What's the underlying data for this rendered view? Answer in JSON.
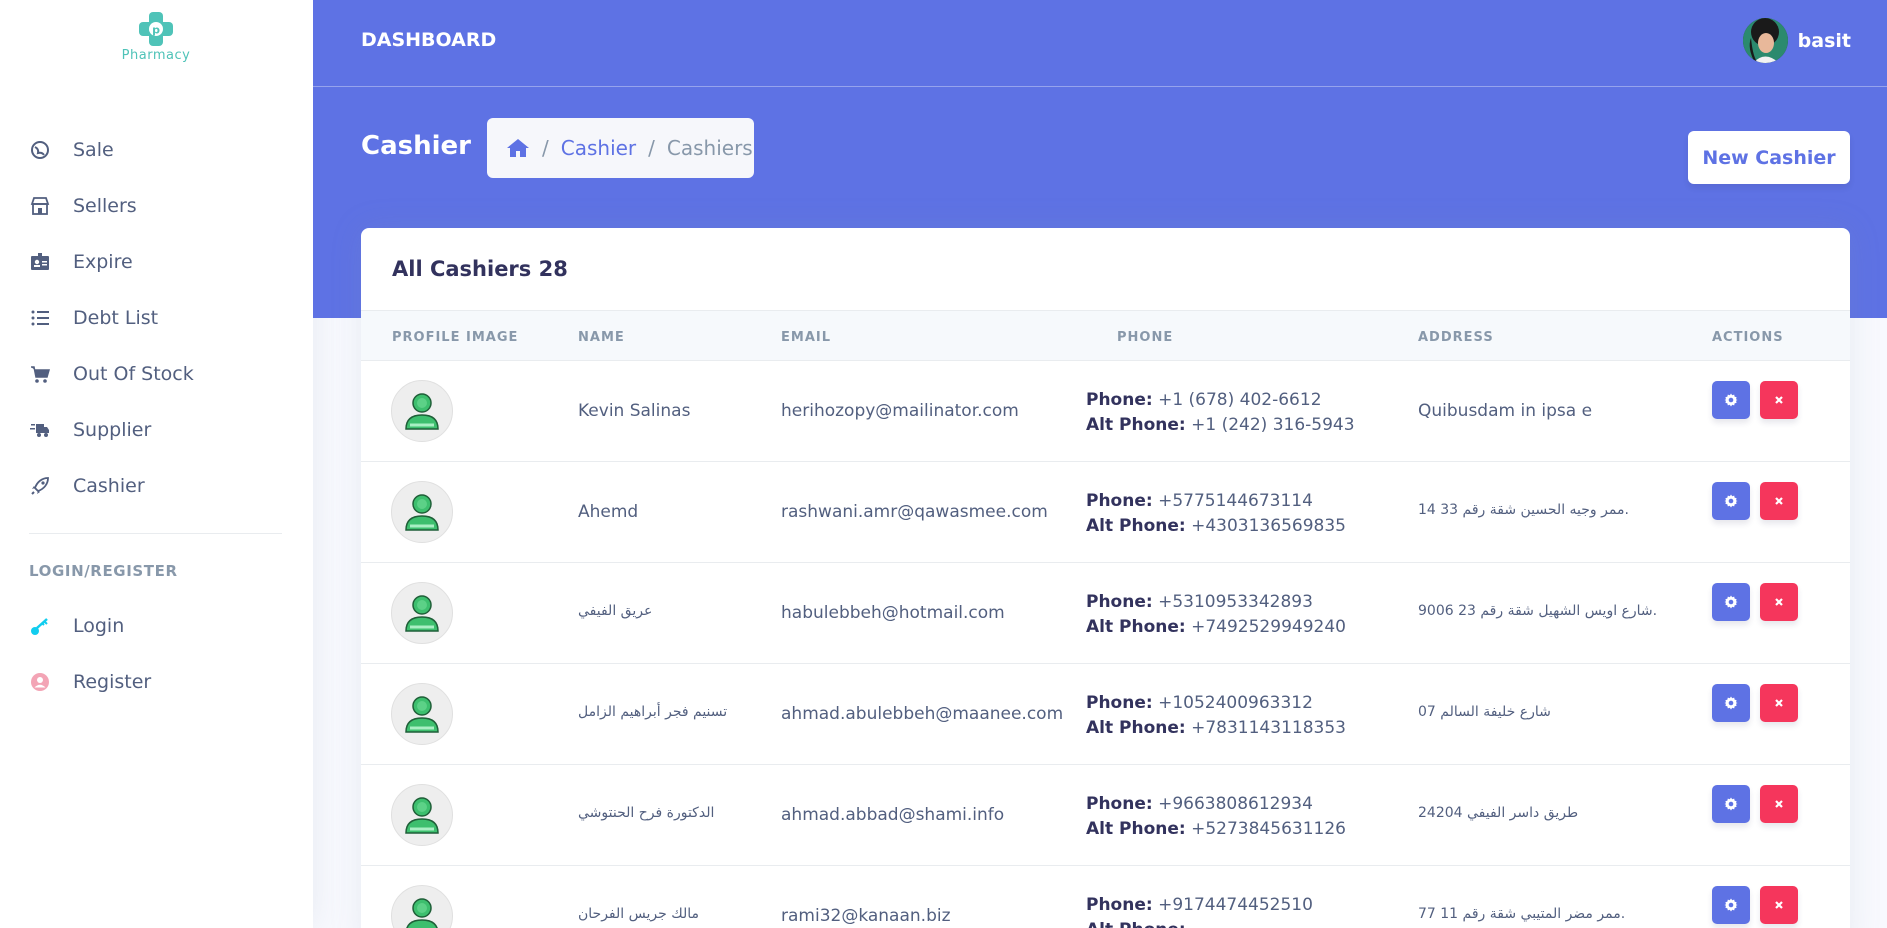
{
  "app": {
    "logo_text": "Pharmacy"
  },
  "sidebar": {
    "items": [
      {
        "label": "Sale",
        "icon": "globe-icon"
      },
      {
        "label": "Sellers",
        "icon": "store-icon"
      },
      {
        "label": "Expire",
        "icon": "id-badge-icon"
      },
      {
        "label": "Debt List",
        "icon": "list-icon"
      },
      {
        "label": "Out Of Stock",
        "icon": "cart-icon"
      },
      {
        "label": "Supplier",
        "icon": "delivery-truck-icon"
      },
      {
        "label": "Cashier",
        "icon": "rocket-icon"
      }
    ],
    "section_heading": "LOGIN/REGISTER",
    "auth_items": [
      {
        "label": "Login",
        "icon": "key-icon",
        "color": "#11cdef"
      },
      {
        "label": "Register",
        "icon": "user-circle-icon",
        "color": "#f3a4b5"
      }
    ]
  },
  "topbar": {
    "title": "DASHBOARD",
    "user_name": "basit"
  },
  "page": {
    "title": "Cashier",
    "breadcrumb": {
      "link": "Cashier",
      "active": "Cashiers",
      "separator": "/"
    },
    "new_button": "New Cashier"
  },
  "table": {
    "title": "All Cashiers 28",
    "columns": [
      "PROFILE IMAGE",
      "NAME",
      "EMAIL",
      "PHONE",
      "ADDRESS",
      "ACTIONS"
    ],
    "phone_label": "Phone:",
    "alt_phone_label": "Alt Phone:",
    "rows": [
      {
        "name": "Kevin Salinas",
        "email": "herihozopy@mailinator.com",
        "phone": "+1 (678) 402-6612",
        "alt_phone": "+1 (242) 316-5943",
        "address": "Quibusdam in ipsa e"
      },
      {
        "name": "Ahemd",
        "email": "rashwani.amr@qawasmee.com",
        "phone": "+5775144673114",
        "alt_phone": "+4303136569835",
        "address": "14 33 ممر وجيه الحسين شقة رقم."
      },
      {
        "name": "عريق الفيفي",
        "email": "habulebbeh@hotmail.com",
        "phone": "+5310953342893",
        "alt_phone": "+7492529949240",
        "address": "9006 23 شارع اويس الشهيل شقة رقم."
      },
      {
        "name": "تسنيم فجر أبراهيم الزامل",
        "email": "ahmad.abulebbeh@maanee.com",
        "phone": "+1052400963312",
        "alt_phone": "+7831143118353",
        "address": "07 شارع خليفة السالم"
      },
      {
        "name": "الدكتورة فرح الحنتوشي",
        "email": "ahmad.abbad@shami.info",
        "phone": "+9663808612934",
        "alt_phone": "+5273845631126",
        "address": "24204 طريق داسر الفيفي"
      },
      {
        "name": "مالك جريس الفرحان",
        "email": "rami32@kanaan.biz",
        "phone": "+9174474452510",
        "alt_phone": "",
        "address": "77 11 ممر مضر المتيبي شقة رقم."
      }
    ]
  },
  "colors": {
    "primary": "#5e72e4",
    "danger": "#f5365c",
    "logo": "#4fc3b8",
    "avatar_green": "#3dbf6e"
  }
}
